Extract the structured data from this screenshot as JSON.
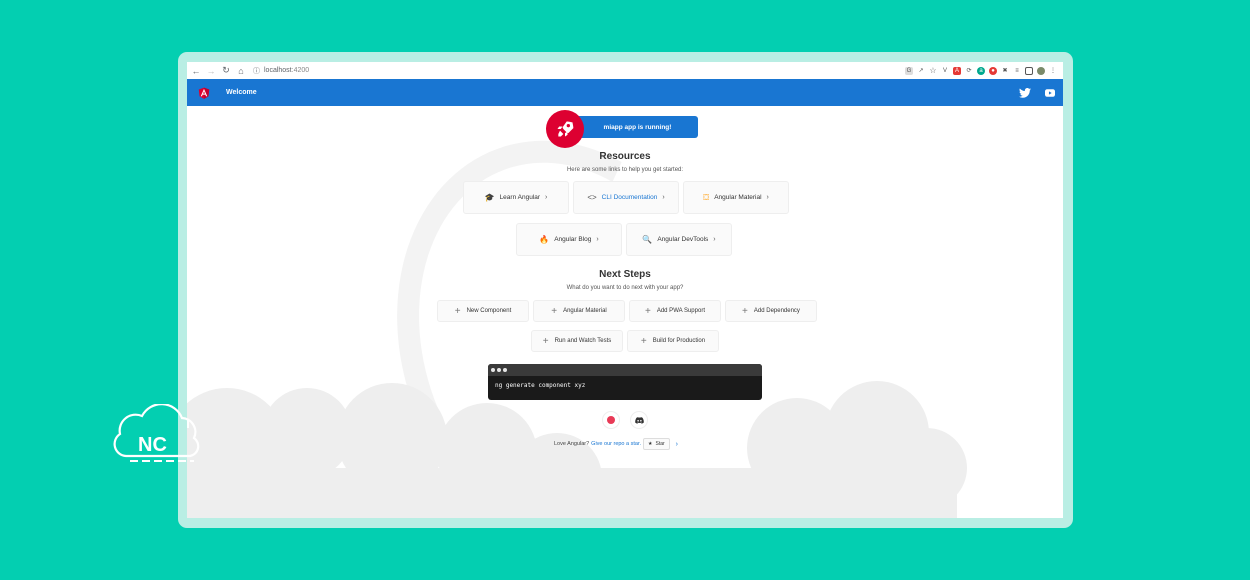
{
  "browser": {
    "url_host": "localhost",
    "url_port": ":4200"
  },
  "toolbar": {
    "title": "Welcome",
    "twitter_icon": "twitter-icon",
    "youtube_icon": "youtube-icon"
  },
  "hero": {
    "running_label": "miapp app is running!",
    "rocket_icon": "rocket-icon"
  },
  "resources": {
    "title": "Resources",
    "subtitle": "Here are some links to help you get started:",
    "cards": [
      {
        "label": "Learn Angular",
        "icon": "graduation-cap-icon"
      },
      {
        "label": "CLI Documentation",
        "icon": "code-icon"
      },
      {
        "label": "Angular Material",
        "icon": "material-shield-icon"
      },
      {
        "label": "Angular Blog",
        "icon": "flame-icon"
      },
      {
        "label": "Angular DevTools",
        "icon": "devtools-search-icon"
      }
    ]
  },
  "next_steps": {
    "title": "Next Steps",
    "subtitle": "What do you want to do next with your app?",
    "items": [
      {
        "label": "New Component"
      },
      {
        "label": "Angular Material"
      },
      {
        "label": "Add PWA Support"
      },
      {
        "label": "Add Dependency"
      },
      {
        "label": "Run and Watch Tests"
      },
      {
        "label": "Build for Production"
      }
    ]
  },
  "terminal": {
    "command": "ng generate component xyz"
  },
  "footer": {
    "love_text": "Love Angular?",
    "repo_link": "Give our repo a star.",
    "star_label": "Star"
  },
  "brand": {
    "nc_text": "NC",
    "accent": "#1976d2",
    "angular_red": "#dd0031",
    "background": "#03cfb1"
  }
}
